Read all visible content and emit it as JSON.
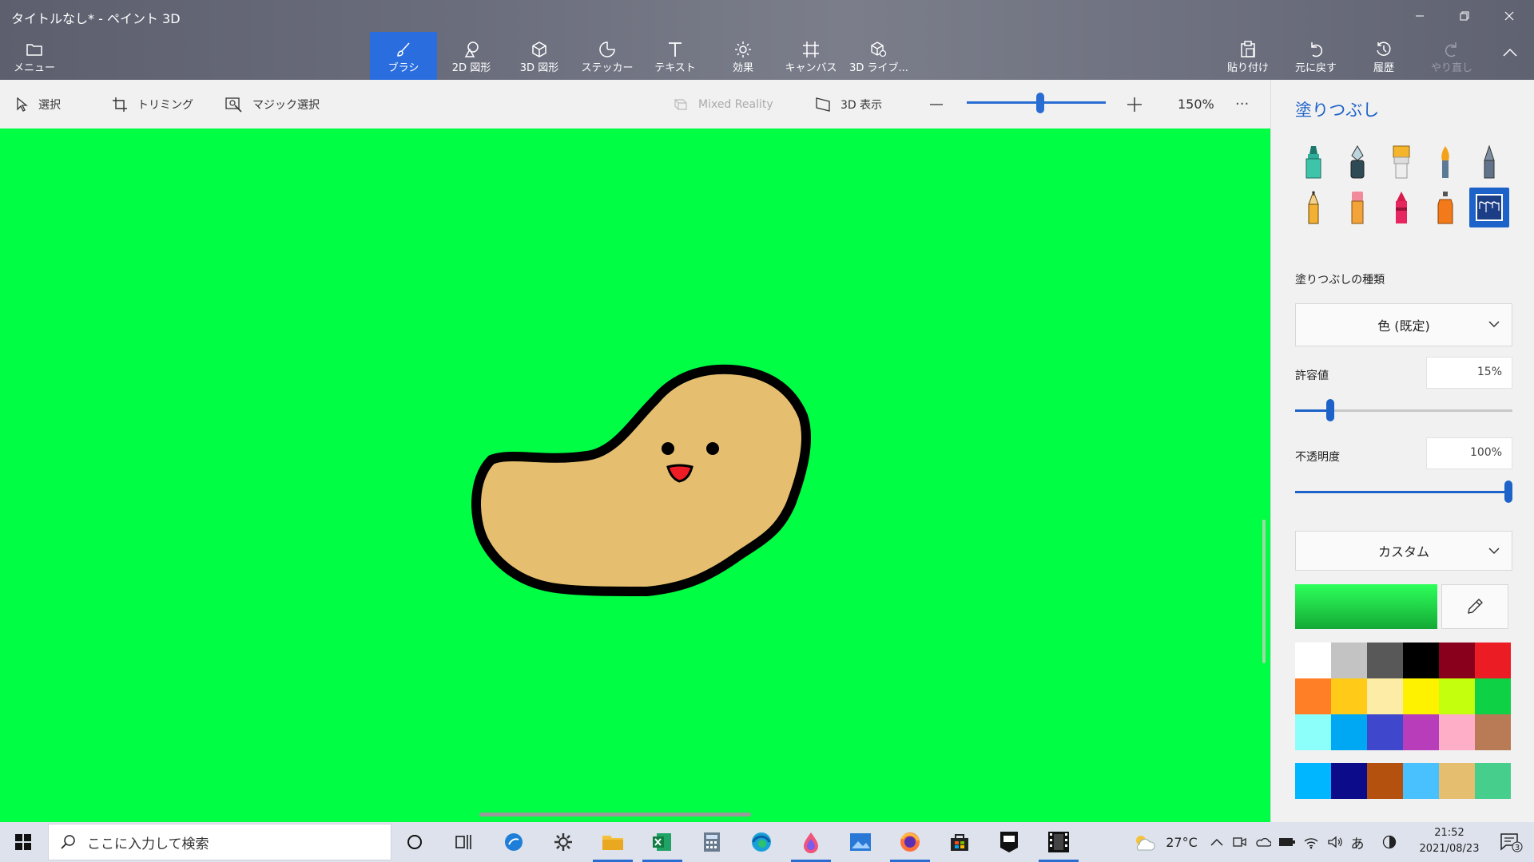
{
  "window": {
    "title": "タイトルなし* - ペイント 3D",
    "minimize_icon": "minimize-icon",
    "restore_icon": "restore-icon",
    "close_icon": "close-icon"
  },
  "toolbar": {
    "menu_label": "メニュー",
    "items": [
      {
        "label": "ブラシ",
        "icon": "brush-icon",
        "active": true
      },
      {
        "label": "2D 図形",
        "icon": "2d-shapes-icon"
      },
      {
        "label": "3D 図形",
        "icon": "3d-shapes-icon"
      },
      {
        "label": "ステッカー",
        "icon": "sticker-icon"
      },
      {
        "label": "テキスト",
        "icon": "text-icon"
      },
      {
        "label": "効果",
        "icon": "effects-icon"
      },
      {
        "label": "キャンバス",
        "icon": "canvas-icon"
      },
      {
        "label": "3D ライブ...",
        "icon": "3d-library-icon"
      }
    ],
    "paste_label": "貼り付け",
    "undo_label": "元に戻す",
    "history_label": "履歴",
    "redo_label": "やり直し"
  },
  "subtoolbar": {
    "select_label": "選択",
    "crop_label": "トリミング",
    "magic_select_label": "マジック選択",
    "mixed_reality_label": "Mixed Reality",
    "view3d_label": "3D 表示",
    "zoom_percent": "150%",
    "zoom_level": 0.53,
    "more_label": "···"
  },
  "panel": {
    "title": "塗りつぶし",
    "brushes": [
      "marker",
      "calligraphy-pen",
      "oil-brush",
      "watercolor",
      "pixel-pen",
      "pencil",
      "eraser",
      "crayon",
      "spray-can",
      "fill"
    ],
    "selected_brush": "fill",
    "fill_type_label": "塗りつぶしの種類",
    "fill_type_value": "色 (既定)",
    "tolerance_label": "許容値",
    "tolerance_value": "15%",
    "tolerance_level": 0.15,
    "opacity_label": "不透明度",
    "opacity_value": "100%",
    "opacity_level": 1.0,
    "color_mode_value": "カスタム",
    "current_color": "#21d548",
    "palette": [
      "#ffffff",
      "#c3c3c3",
      "#585858",
      "#000000",
      "#88001b",
      "#ec1c24",
      "#ff7f27",
      "#ffca18",
      "#fdeca6",
      "#fff200",
      "#c4ff0e",
      "#0ed145",
      "#8cfffb",
      "#00a8f3",
      "#3f48cc",
      "#b83dba",
      "#ffaec8",
      "#b97a56"
    ],
    "custom_palette": [
      "#00b7ff",
      "#0c0c8a",
      "#b5510e",
      "#4ac1ff",
      "#e5bf6f",
      "#46cf8c"
    ]
  },
  "canvas": {
    "background": "#00ff44",
    "blob_fill": "#e5bf6f",
    "outline": "#000000",
    "mouth_fill": "#ee1c24"
  },
  "taskbar": {
    "search_placeholder": "ここに入力して検索",
    "weather_temp": "27°C",
    "ime_label": "あ",
    "time": "21:52",
    "date": "2021/08/23",
    "notification_count": "3",
    "apps": [
      "cortana-icon",
      "task-view-icon",
      "edge-legacy-icon",
      "settings-icon",
      "file-explorer-icon",
      "excel-icon",
      "calculator-icon",
      "edge-icon",
      "paint3d-icon",
      "photos-icon",
      "firefox-icon",
      "store-icon",
      "epic-games-icon",
      "video-editor-icon"
    ]
  }
}
